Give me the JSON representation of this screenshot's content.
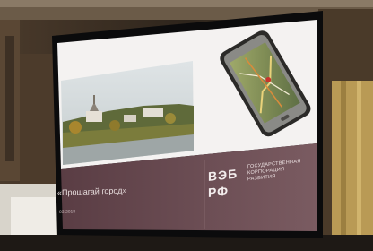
{
  "slide": {
    "title": "«Прошагай город»",
    "date": "03.2018"
  },
  "logo": {
    "mark_line1": "ВЭБ",
    "mark_line2": "РФ",
    "caption_line1": "ГОСУДАРСТВЕННАЯ",
    "caption_line2": "КОРПОРАЦИЯ",
    "caption_line3": "РАЗВИТИЯ"
  },
  "colors": {
    "slide_band": "#6e4f56",
    "slide_white": "#f4f2f1",
    "room_wall": "#3b2f23"
  }
}
